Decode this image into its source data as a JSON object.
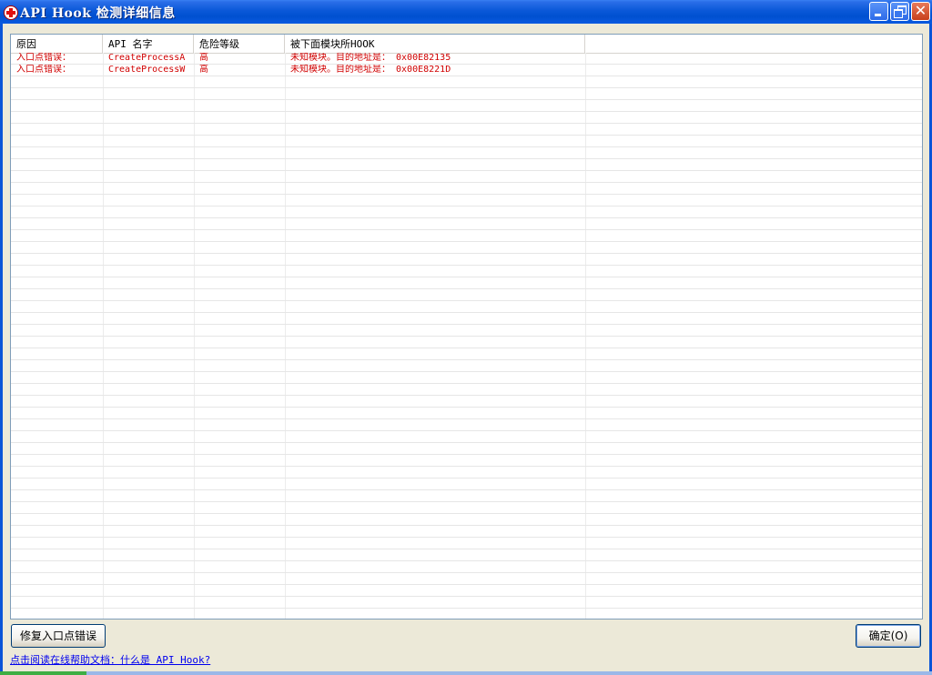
{
  "window": {
    "title": "API Hook 检测详细信息"
  },
  "table": {
    "columns": [
      "原因",
      "API 名字",
      "危险等级",
      "被下面模块所HOOK",
      ""
    ],
    "rows": [
      [
        "入口点错误：",
        "CreateProcessA",
        "高",
        "未知模块。目的地址是： 0x00E82135"
      ],
      [
        "入口点错误：",
        "CreateProcessW",
        "高",
        "未知模块。目的地址是： 0x00E8221D"
      ]
    ],
    "row_text_color": "#d00000"
  },
  "buttons": {
    "repair_label": "修复入口点错误",
    "ok_label": "确定(O)"
  },
  "help_link": "点击阅读在线帮助文档：什么是 API Hook?",
  "colors": {
    "titlebar": "#0a58d8",
    "dialog_bg": "#ece9d8",
    "link": "#0000ee"
  }
}
